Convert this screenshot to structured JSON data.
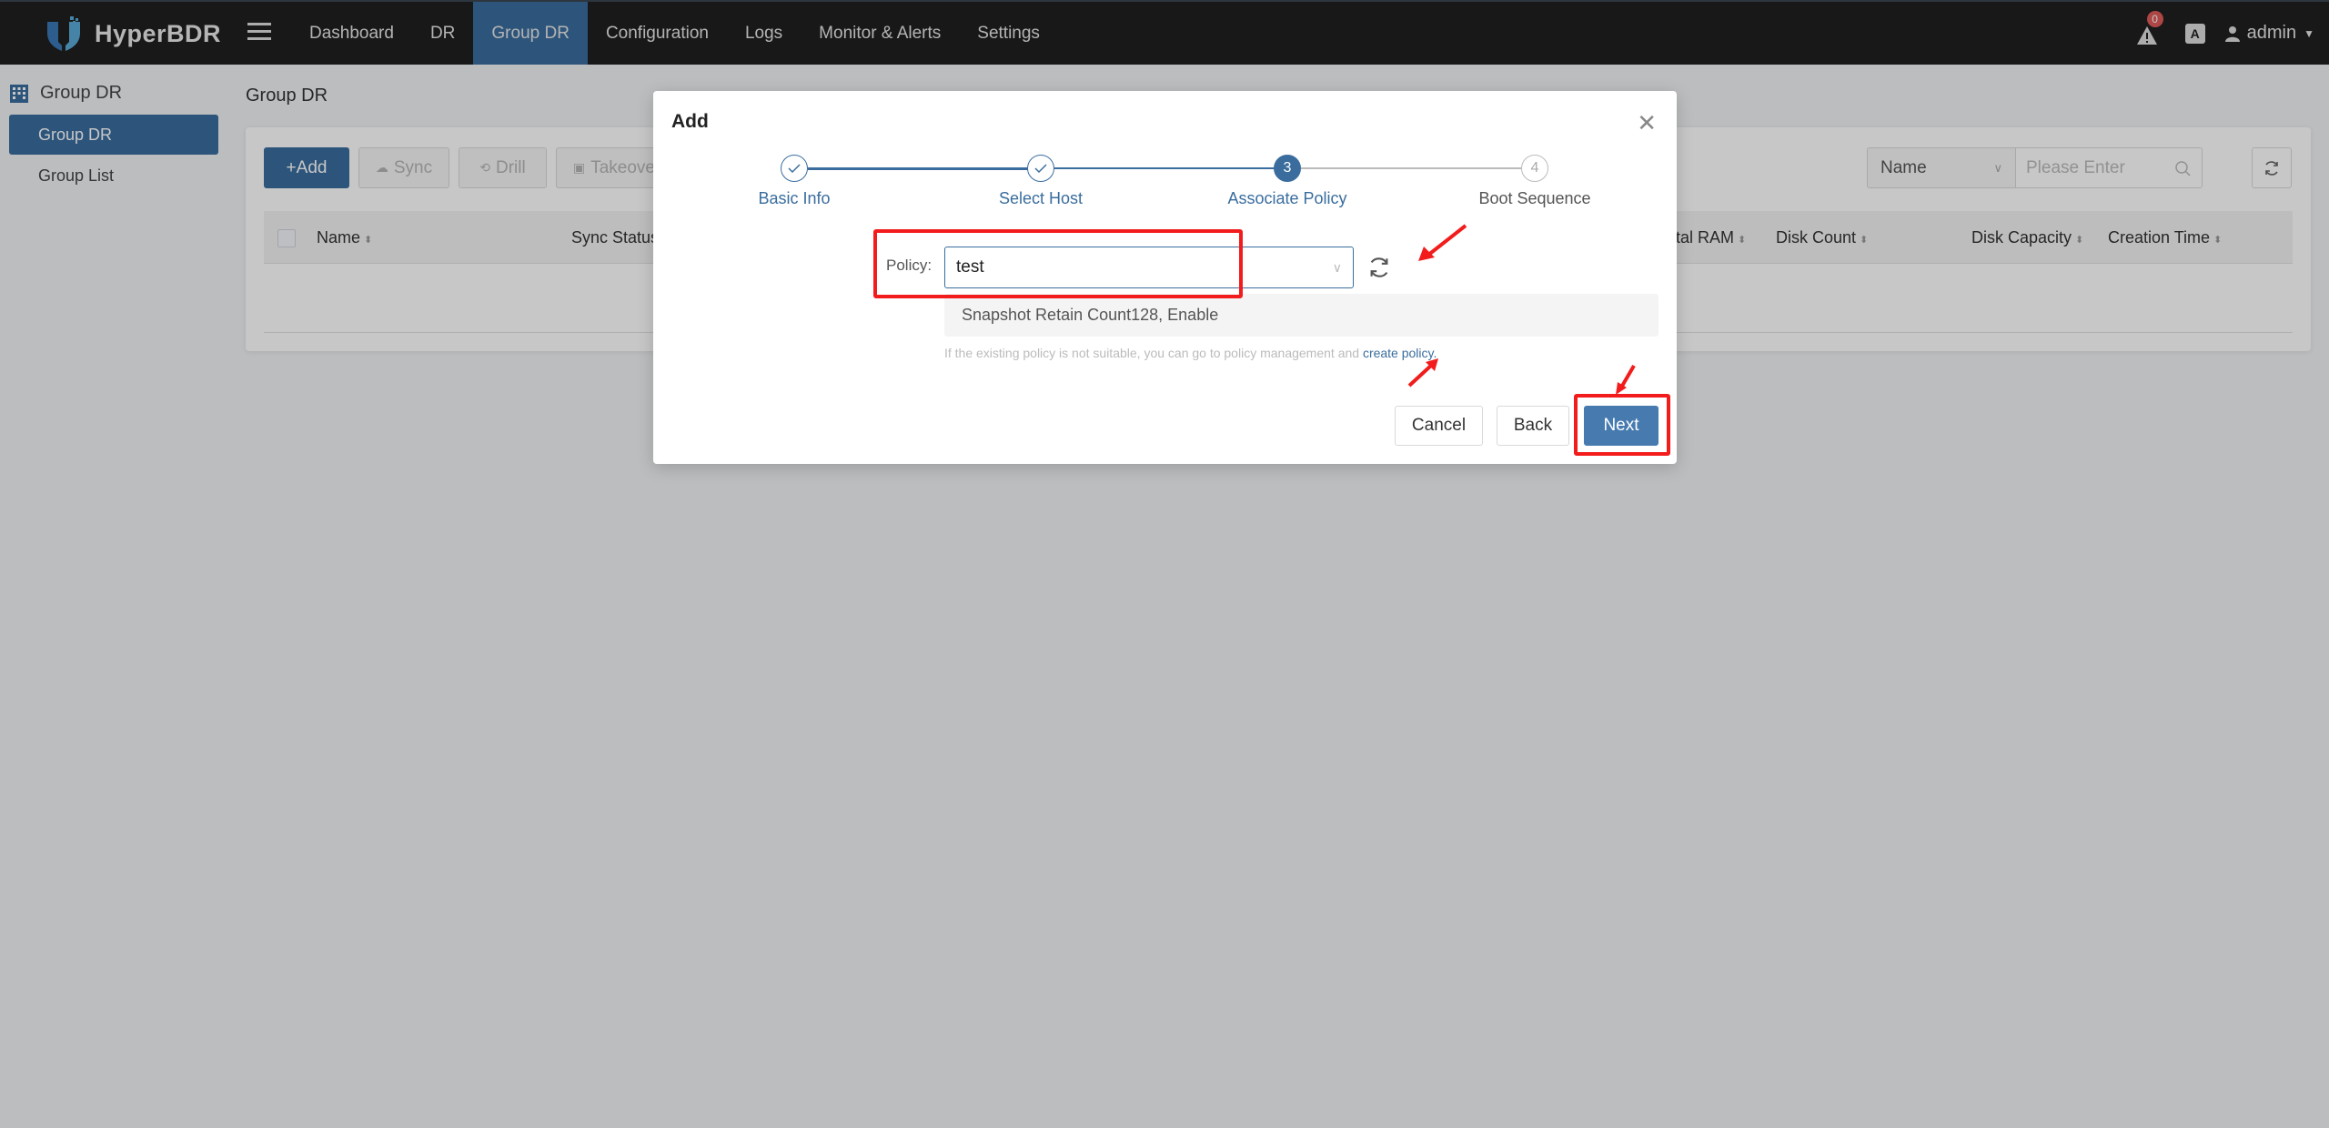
{
  "app": {
    "name": "HyperBDR",
    "nav": [
      {
        "label": "Dashboard",
        "active": false
      },
      {
        "label": "DR",
        "active": false
      },
      {
        "label": "Group DR",
        "active": true
      },
      {
        "label": "Configuration",
        "active": false
      },
      {
        "label": "Logs",
        "active": false
      },
      {
        "label": "Monitor & Alerts",
        "active": false
      },
      {
        "label": "Settings",
        "active": false
      }
    ],
    "alert_count": "0",
    "translate_glyph": "A",
    "user": "admin",
    "accent_color": "#3a6d9e"
  },
  "sidebar": {
    "header": "Group DR",
    "items": [
      {
        "label": "Group DR",
        "active": true
      },
      {
        "label": "Group List",
        "active": false
      }
    ]
  },
  "page": {
    "title": "Group DR",
    "toolbar": {
      "add": "+Add",
      "sync": "Sync",
      "drill": "Drill",
      "takeover": "Takeove"
    },
    "search": {
      "field": "Name",
      "placeholder": "Please Enter"
    },
    "table": {
      "columns": [
        "Name",
        "Sync Status",
        "tal RAM",
        "Disk Count",
        "Disk Capacity",
        "Creation Time"
      ],
      "rows": []
    }
  },
  "modal": {
    "title": "Add",
    "steps": [
      {
        "number": "1",
        "label": "Basic Info",
        "status": "finished"
      },
      {
        "number": "2",
        "label": "Select Host",
        "status": "finished"
      },
      {
        "number": "3",
        "label": "Associate Policy",
        "status": "current"
      },
      {
        "number": "4",
        "label": "Boot Sequence",
        "status": "waiting"
      }
    ],
    "policy_label": "Policy:",
    "policy_value": "test",
    "policy_info": "Snapshot Retain Count128, Enable",
    "hint_text": "If the existing policy is not suitable, you can go to policy management and ",
    "hint_link": "create policy.",
    "buttons": {
      "cancel": "Cancel",
      "back": "Back",
      "next": "Next"
    }
  }
}
